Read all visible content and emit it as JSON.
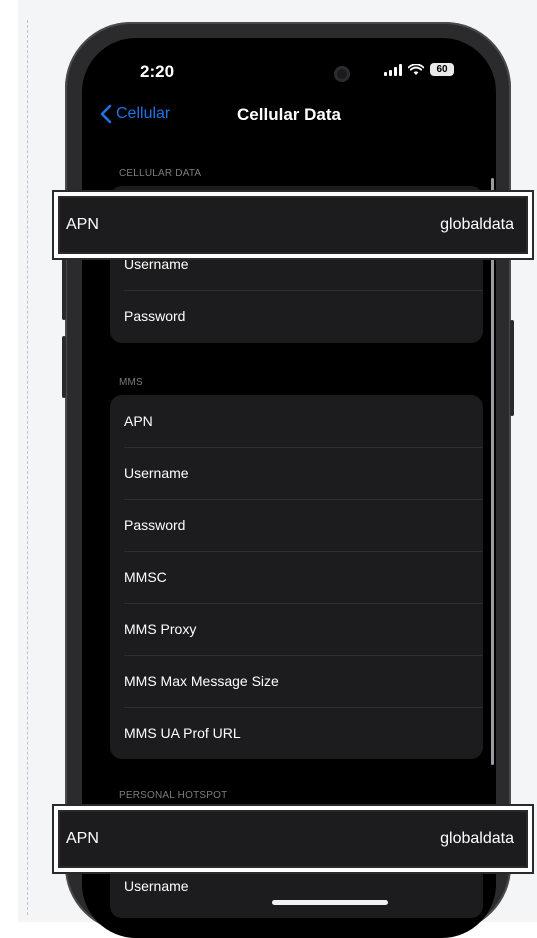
{
  "status_bar": {
    "time": "2:20",
    "battery": "60"
  },
  "nav": {
    "back_label": "Cellular",
    "title": "Cellular Data"
  },
  "cellular_data": {
    "header": "CELLULAR DATA",
    "rows": [
      "Username",
      "Password"
    ]
  },
  "mms": {
    "header": "MMS",
    "rows": [
      "APN",
      "Username",
      "Password",
      "MMSC",
      "MMS Proxy",
      "MMS Max Message Size",
      "MMS UA Prof URL"
    ]
  },
  "personal_hotspot": {
    "header": "PERSONAL HOTSPOT",
    "rows": [
      "Username"
    ]
  },
  "callouts": [
    {
      "label": "APN",
      "value": "globaldata"
    },
    {
      "label": "APN",
      "value": "globaldata"
    }
  ]
}
